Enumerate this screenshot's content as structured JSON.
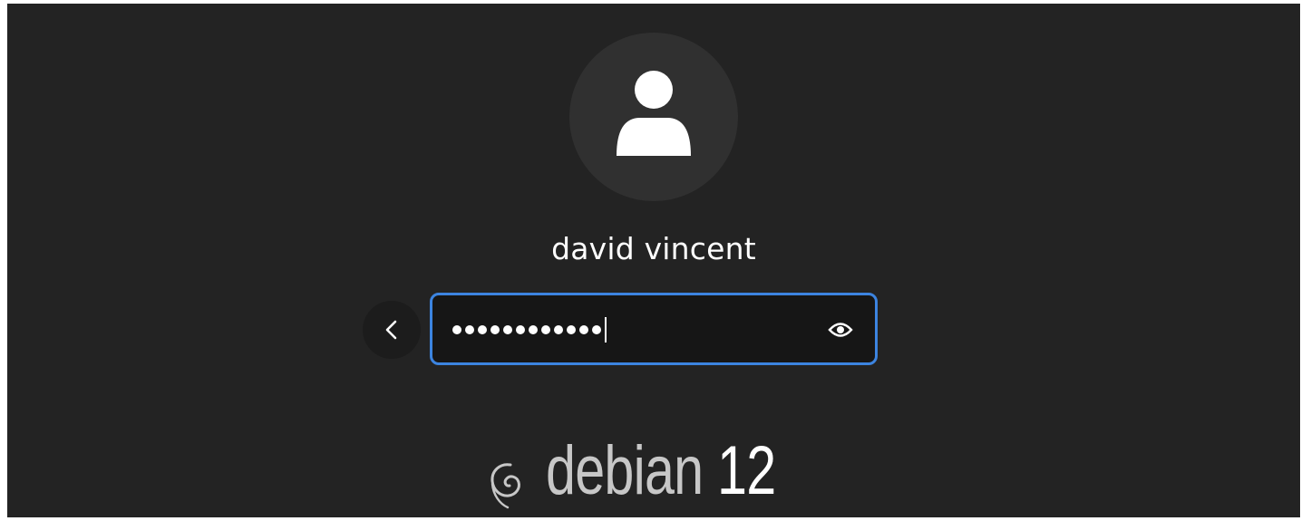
{
  "user": {
    "display_name": "david vincent",
    "avatar_icon": "user-silhouette-icon"
  },
  "login": {
    "password_masked_length": 12,
    "show_password_icon": "eye-icon",
    "back_icon": "chevron-left-icon"
  },
  "branding": {
    "logo_icon": "debian-swirl-icon",
    "distro_name": "debian",
    "version": "12"
  },
  "colors": {
    "background": "#232323",
    "field_border": "#3c84e0",
    "text": "#ffffff",
    "logo_text": "#c7c7c7"
  }
}
